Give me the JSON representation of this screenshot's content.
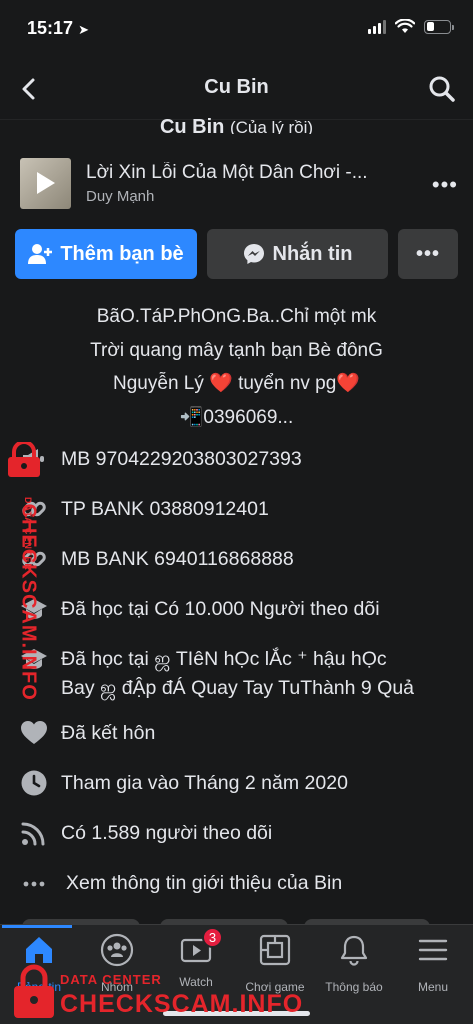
{
  "status": {
    "time": "15:17",
    "battery_level": 0.35
  },
  "nav": {
    "title": "Cu Bin"
  },
  "profile": {
    "name_peek": "Cu Bin",
    "name_sub": "(Của lý rồi)"
  },
  "music": {
    "title": "Lời Xin Lỗi Của Một Dân Chơi -...",
    "artist": "Duy Mạnh"
  },
  "actions": {
    "add_friend": "Thêm bạn bè",
    "message": "Nhắn tin",
    "more": "•••"
  },
  "bio": [
    "BãO.TáP.PhOnG.Ba..Chỉ một mk",
    "Trời quang mây tạnh bạn Bè đônG",
    "Nguyễn Lý ❤️ tuyển nv pg❤️",
    "📲0396069..."
  ],
  "info": [
    {
      "icon": "megaphone-icon",
      "text": "MB 9704229203803027393"
    },
    {
      "icon": "link-icon",
      "text": "TP BANK 03880912401"
    },
    {
      "icon": "link-icon",
      "text": "MB BANK 6940116868888"
    },
    {
      "icon": "graduation-cap-icon",
      "text": "Đã học tại Có 10.000 Người theo dõi"
    },
    {
      "icon": "graduation-cap-icon",
      "text": "Đã học tại ஜ TIêN hỌc lẮc ⁺ hậu hỌc",
      "text2": "Bay ஜ đẬp đÁ Quay Tay TuThành 9 Quả"
    },
    {
      "icon": "heart-icon",
      "text": "Đã kết hôn"
    },
    {
      "icon": "clock-icon",
      "text": "Tham gia vào Tháng 2 năm 2020"
    },
    {
      "icon": "rss-icon",
      "text": "Có 1.589 người theo dõi"
    },
    {
      "icon": "ellipsis-icon",
      "text": "Xem thông tin giới thiệu của Bin"
    }
  ],
  "tabs": [
    {
      "label": "Bảng tin",
      "icon": "home-icon"
    },
    {
      "label": "Nhóm",
      "icon": "groups-icon"
    },
    {
      "label": "Watch",
      "icon": "watch-icon",
      "badge": "3"
    },
    {
      "label": "Chơi game",
      "icon": "gaming-icon"
    },
    {
      "label": "Thông báo",
      "icon": "bell-icon"
    },
    {
      "label": "Menu",
      "icon": "menu-icon"
    }
  ],
  "watermark": {
    "brand": "CHECKSCAM.INFO",
    "tag": "DATA CENTER"
  },
  "colors": {
    "accent": "#2d88ff",
    "background": "#18191a",
    "badge": "#e41e3f",
    "watermark": "#e4252b"
  }
}
